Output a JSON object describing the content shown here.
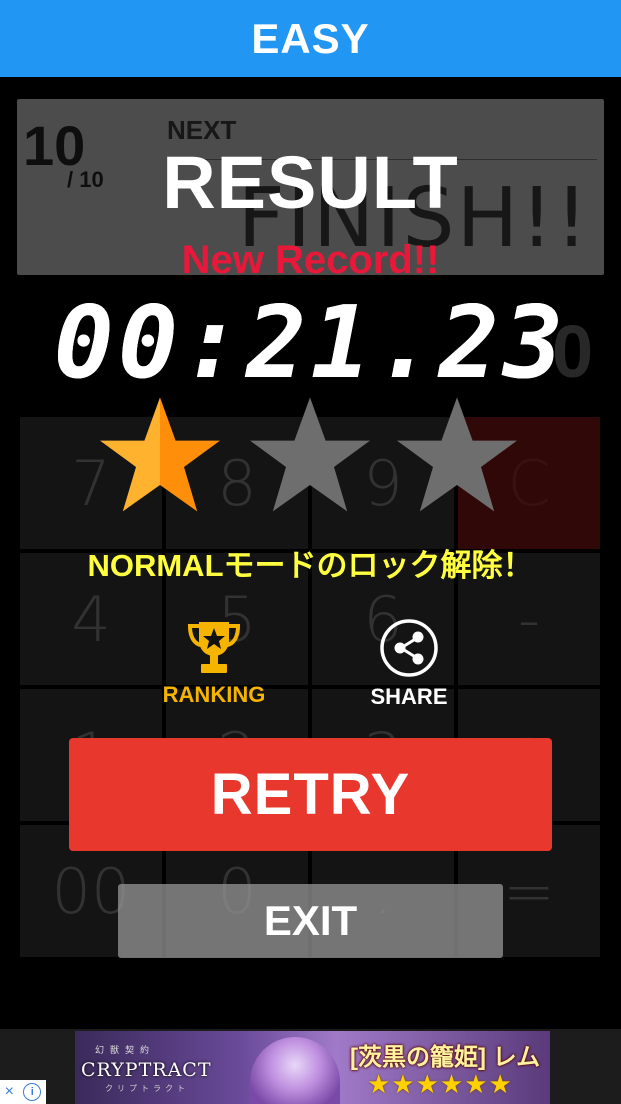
{
  "header": {
    "title": "EASY"
  },
  "game": {
    "question_count": "10",
    "question_total": "/ 10",
    "next_label": "NEXT",
    "finish_text": "FINISH!!",
    "side_digit": "0",
    "keypad": [
      "7",
      "8",
      "9",
      "C",
      "4",
      "5",
      "6",
      "-",
      "1",
      "2",
      "3",
      "+",
      "00",
      "0",
      ".",
      "="
    ]
  },
  "result": {
    "title": "RESULT",
    "new_record": "New Record!!",
    "time": "00:21.23",
    "stars_earned": 1,
    "stars_total": 3,
    "unlock_message": "NORMALモードのロック解除！",
    "ranking_label": "RANKING",
    "share_label": "SHARE",
    "retry_label": "RETRY",
    "exit_label": "EXIT"
  },
  "ad": {
    "title": "CRYPTRACT",
    "subtitle": "幻獣契約",
    "subtitle_small": "クリプトラクト",
    "character": "[茨黒の籠姫] レム",
    "rating": "★★★★★★",
    "close_icon": "×",
    "info_icon": "i"
  },
  "colors": {
    "header": "#2196f3",
    "retry": "#e8382e",
    "new_record": "#e8183a",
    "unlock": "#ffff40",
    "ranking": "#f5b400",
    "star_active": "#ff9f1a",
    "star_inactive": "#6e6e6e"
  }
}
